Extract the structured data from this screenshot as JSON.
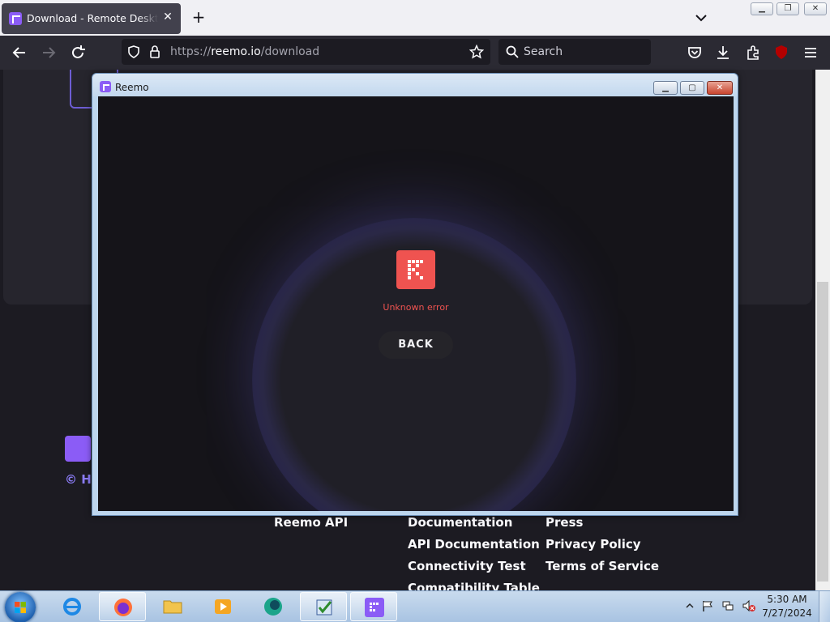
{
  "browser": {
    "tab_title": "Download - Remote Desktop So",
    "url_host": "reemo.io",
    "url_scheme": "https://",
    "url_path": "/download",
    "search_placeholder": "Search",
    "extension_badge": "2"
  },
  "page": {
    "copyright": "© Hu",
    "footer_links": [
      "Reemo API",
      "Documentation",
      "API Documentation",
      "Connectivity Test",
      "Compatibility Table",
      "Press",
      "Privacy Policy",
      "Terms of Service"
    ]
  },
  "dialog": {
    "title": "Reemo",
    "error_message": "Unknown error",
    "back_label": "BACK"
  },
  "taskbar": {
    "time": "5:30 AM",
    "date": "7/27/2024"
  },
  "colors": {
    "accent": "#8b5cf6",
    "error": "#ef5350"
  }
}
